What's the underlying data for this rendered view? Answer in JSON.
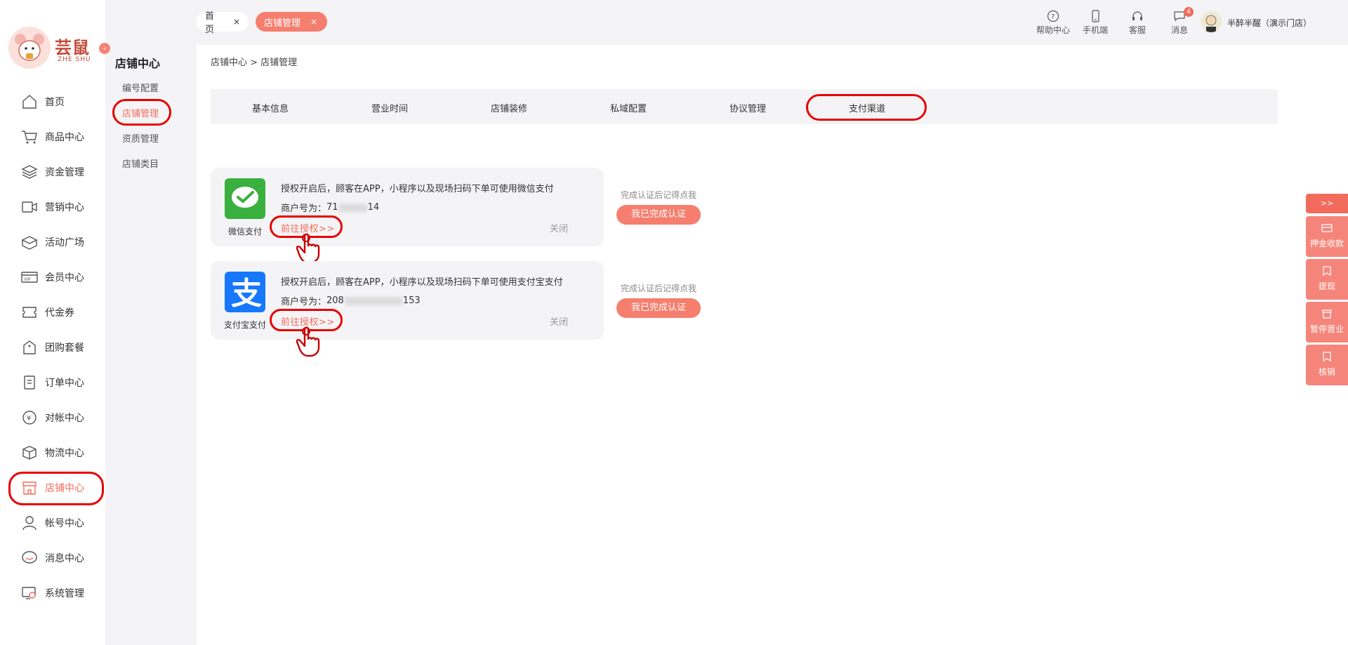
{
  "brand": {
    "logo_text": "芸鼠",
    "logo_sub": "ZHE SHU"
  },
  "sidebar": {
    "items": [
      {
        "label": "首页",
        "icon": "home-icon"
      },
      {
        "label": "商品中心",
        "icon": "cart-icon"
      },
      {
        "label": "资金管理",
        "icon": "layers-icon"
      },
      {
        "label": "营销中心",
        "icon": "video-icon"
      },
      {
        "label": "活动广场",
        "icon": "box-icon"
      },
      {
        "label": "会员中心",
        "icon": "vip-card-icon"
      },
      {
        "label": "代金券",
        "icon": "ticket-icon"
      },
      {
        "label": "团购套餐",
        "icon": "tag-icon"
      },
      {
        "label": "订单中心",
        "icon": "document-icon"
      },
      {
        "label": "对帐中心",
        "icon": "yuan-icon"
      },
      {
        "label": "物流中心",
        "icon": "package-icon"
      },
      {
        "label": "店铺中心",
        "icon": "store-icon",
        "active": true
      },
      {
        "label": "帐号中心",
        "icon": "user-icon"
      },
      {
        "label": "消息中心",
        "icon": "chat-icon"
      },
      {
        "label": "系统管理",
        "icon": "settings-monitor-icon"
      }
    ]
  },
  "submenu": {
    "title": "店铺中心",
    "items": [
      "编号配置",
      "店铺管理",
      "资质管理",
      "店铺类目"
    ],
    "active_index": 1
  },
  "topbar": {
    "tabs": [
      {
        "label": "首页",
        "close": "×"
      },
      {
        "label": "店铺管理",
        "close": "×"
      }
    ],
    "tools": [
      {
        "label": "帮助中心",
        "icon": "help-icon"
      },
      {
        "label": "手机端",
        "icon": "mobile-icon"
      },
      {
        "label": "客服",
        "icon": "headset-icon"
      },
      {
        "label": "消息",
        "icon": "message-icon",
        "badge": "4"
      }
    ],
    "user_name": "半醉半醒（演示门店）"
  },
  "main": {
    "breadcrumb": "店铺中心 > 店铺管理",
    "tabs": [
      "基本信息",
      "营业时间",
      "店铺装修",
      "私域配置",
      "协议管理",
      "支付渠道"
    ],
    "active_tab": 5,
    "channels": [
      {
        "name": "微信支付",
        "icon": "wechat-pay-icon",
        "brand_color": "#3ab03e",
        "desc": "授权开启后，顾客在APP，小程序以及现场扫码下单可使用微信支付",
        "merchant_label": "商户号为：",
        "merchant_prefix": "71",
        "merchant_suffix": "14",
        "auth_link": "前往授权>>",
        "close_label": "关闭",
        "confirm_tip": "完成认证后记得点我",
        "confirm_button": "我已完成认证"
      },
      {
        "name": "支付宝支付",
        "icon": "alipay-icon",
        "brand_color": "#1677ff",
        "desc": "授权开启后，顾客在APP，小程序以及现场扫码下单可使用支付宝支付",
        "merchant_label": "商户号为：",
        "merchant_prefix": "208",
        "merchant_suffix": "153",
        "auth_link": "前往授权>>",
        "close_label": "关闭",
        "confirm_tip": "完成认证后记得点我",
        "confirm_button": "我已完成认证"
      }
    ]
  },
  "float_tools": {
    "expand": ">>",
    "items": [
      {
        "label": "押金收款",
        "icon": "deposit-icon"
      },
      {
        "label": "提现",
        "icon": "withdraw-icon"
      },
      {
        "label": "暂停营业",
        "icon": "pause-store-icon"
      },
      {
        "label": "核销",
        "icon": "verify-icon"
      }
    ]
  },
  "colors": {
    "accent": "#f26c5d",
    "highlight_ring": "#e80000"
  }
}
